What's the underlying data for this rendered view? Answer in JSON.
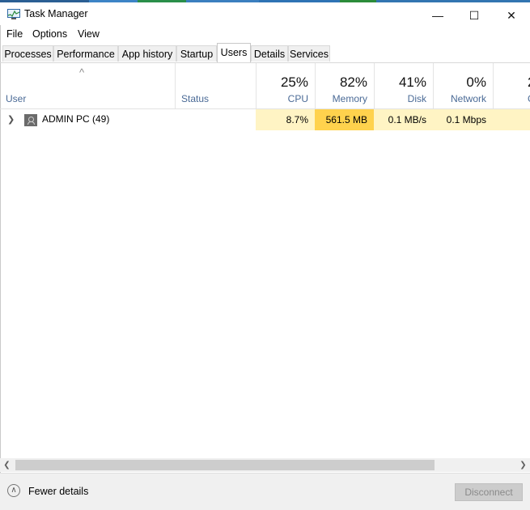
{
  "window": {
    "title": "Task Manager"
  },
  "window_buttons": {
    "minimize": "—",
    "maximize": "☐",
    "close": "✕"
  },
  "menu": [
    "File",
    "Options",
    "View"
  ],
  "tabs": [
    "Processes",
    "Performance",
    "App history",
    "Startup",
    "Users",
    "Details",
    "Services"
  ],
  "active_tab": "Users",
  "columns": {
    "user": "User",
    "status": "Status",
    "cpu": {
      "percent": "25%",
      "label": "CPU"
    },
    "memory": {
      "percent": "82%",
      "label": "Memory"
    },
    "disk": {
      "percent": "41%",
      "label": "Disk"
    },
    "network": {
      "percent": "0%",
      "label": "Network"
    },
    "gpu": {
      "percent": "2",
      "label": "G"
    }
  },
  "rows": [
    {
      "user": "ADMIN PC (49)",
      "status": "",
      "cpu": "8.7%",
      "memory": "561.5 MB",
      "disk": "0.1 MB/s",
      "network": "0.1 Mbps"
    }
  ],
  "footer": {
    "fewer_details": "Fewer details",
    "disconnect": "Disconnect"
  },
  "colors": {
    "heat_light": "#fff4c4",
    "heat_strong": "#ffd24d",
    "header_label": "#4a6a96"
  }
}
